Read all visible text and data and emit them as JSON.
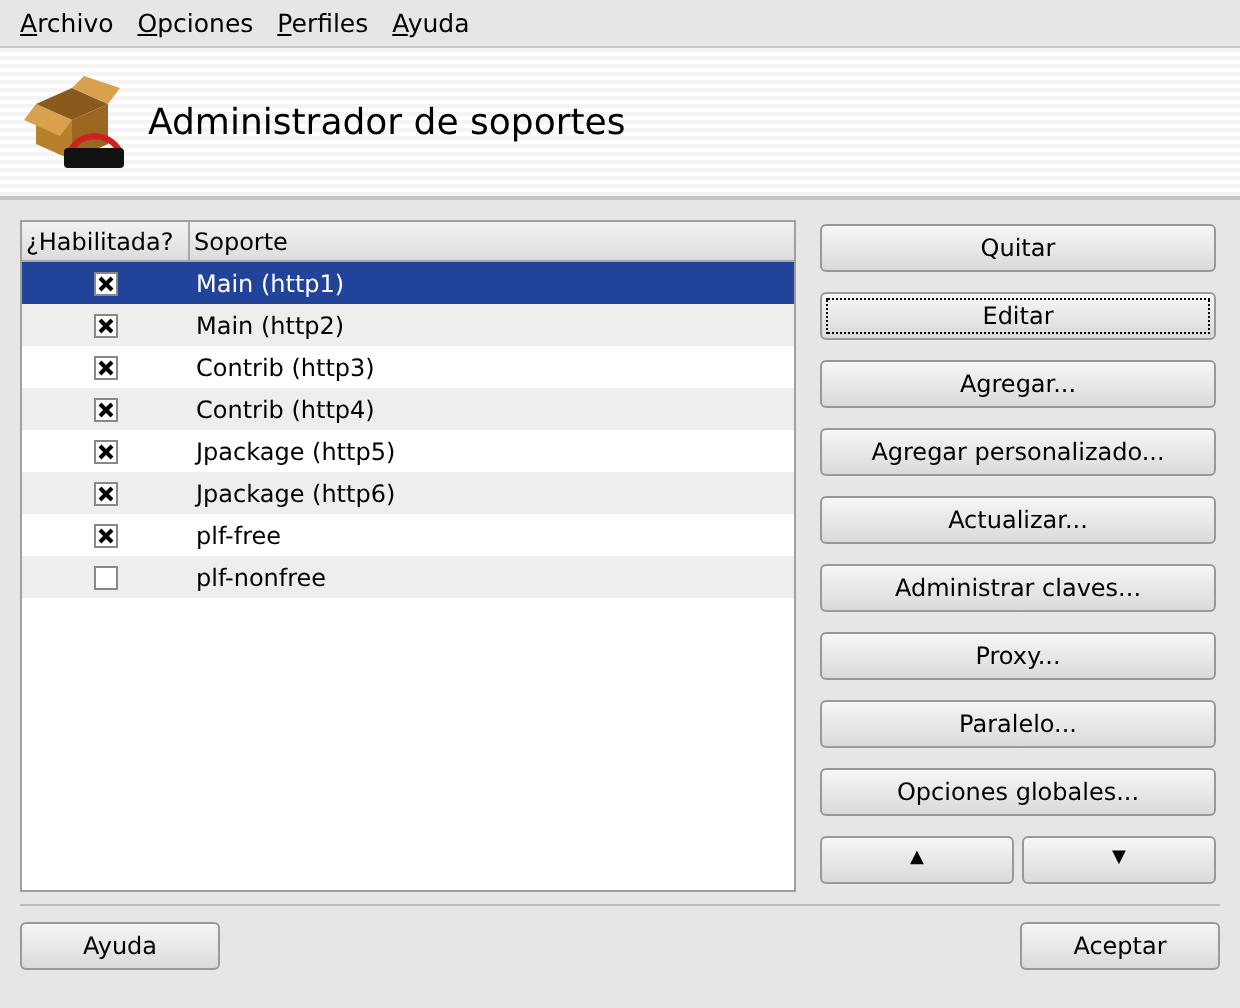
{
  "menu": [
    "Archivo",
    "Opciones",
    "Perfiles",
    "Ayuda"
  ],
  "header": {
    "title": "Administrador de soportes"
  },
  "table": {
    "columns": [
      "¿Habilitada?",
      "Soporte"
    ],
    "rows": [
      {
        "enabled": true,
        "name": "Main (http1)",
        "selected": true
      },
      {
        "enabled": true,
        "name": "Main (http2)",
        "selected": false
      },
      {
        "enabled": true,
        "name": "Contrib (http3)",
        "selected": false
      },
      {
        "enabled": true,
        "name": "Contrib (http4)",
        "selected": false
      },
      {
        "enabled": true,
        "name": "Jpackage (http5)",
        "selected": false
      },
      {
        "enabled": true,
        "name": "Jpackage (http6)",
        "selected": false
      },
      {
        "enabled": true,
        "name": "plf-free",
        "selected": false
      },
      {
        "enabled": false,
        "name": "plf-nonfree",
        "selected": false
      }
    ]
  },
  "buttons": [
    {
      "label": "Quitar",
      "focused": false
    },
    {
      "label": "Editar",
      "focused": true
    },
    {
      "label": "Agregar...",
      "focused": false
    },
    {
      "label": "Agregar personalizado...",
      "focused": false
    },
    {
      "label": "Actualizar...",
      "focused": false
    },
    {
      "label": "Administrar claves...",
      "focused": false
    },
    {
      "label": "Proxy...",
      "focused": false
    },
    {
      "label": "Paralelo...",
      "focused": false
    },
    {
      "label": "Opciones globales...",
      "focused": false
    }
  ],
  "move_buttons": [
    "▲",
    "▼"
  ],
  "footer": {
    "help": "Ayuda",
    "ok": "Aceptar"
  }
}
